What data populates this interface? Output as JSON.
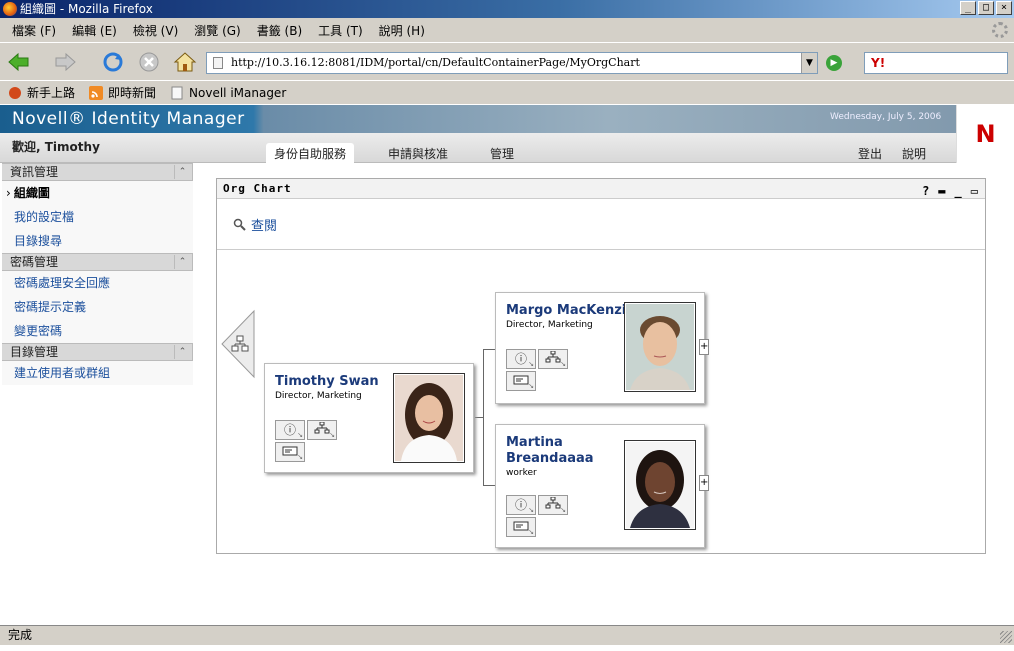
{
  "window": {
    "title": "組織圖 - Mozilla Firefox",
    "min": "_",
    "max": "□",
    "close": "×"
  },
  "menu": [
    "檔案 (F)",
    "編輯 (E)",
    "檢視 (V)",
    "瀏覽 (G)",
    "書籤 (B)",
    "工具 (T)",
    "說明 (H)"
  ],
  "address": {
    "url": "http://10.3.16.12:8081/IDM/portal/cn/DefaultContainerPage/MyOrgChart"
  },
  "search": {
    "engine": "Y!"
  },
  "bookmarks": [
    "新手上路",
    "即時新聞",
    "Novell iManager"
  ],
  "banner": {
    "title": "Novell® Identity Manager",
    "date": "Wednesday, July 5, 2006",
    "logo": "N"
  },
  "welcome": "歡迎, Timothy",
  "tabs": {
    "self_service": "身份自助服務",
    "request": "申請與核准",
    "admin": "管理",
    "logout": "登出",
    "help": "說明"
  },
  "sidebar": {
    "sections": [
      {
        "title": "資訊管理",
        "items": [
          "組織圖",
          "我的設定檔",
          "目錄搜尋"
        ]
      },
      {
        "title": "密碼管理",
        "items": [
          "密碼處理安全回應",
          "密碼提示定義",
          "變更密碼"
        ]
      },
      {
        "title": "目錄管理",
        "items": [
          "建立使用者或群組"
        ]
      }
    ],
    "collapse_glyph": "⌃"
  },
  "portlet": {
    "title": "Org Chart",
    "lookup": "查閱",
    "help": "?",
    "print": "▬",
    "min": "_",
    "max": "▭"
  },
  "org": {
    "manager": {
      "name": "Timothy Swan",
      "title": "Director, Marketing"
    },
    "reports": [
      {
        "name": "Margo MacKenzie",
        "title": "Director, Marketing"
      },
      {
        "name": "Martina Breandaaaa",
        "title": "worker"
      }
    ],
    "expand": "+",
    "info_glyph": "ⓘ",
    "corner_glyph": "↘"
  },
  "status": "完成",
  "colors": {
    "link": "#1b4f9c",
    "name": "#1b3a7a",
    "novell_red": "#cc0000"
  }
}
